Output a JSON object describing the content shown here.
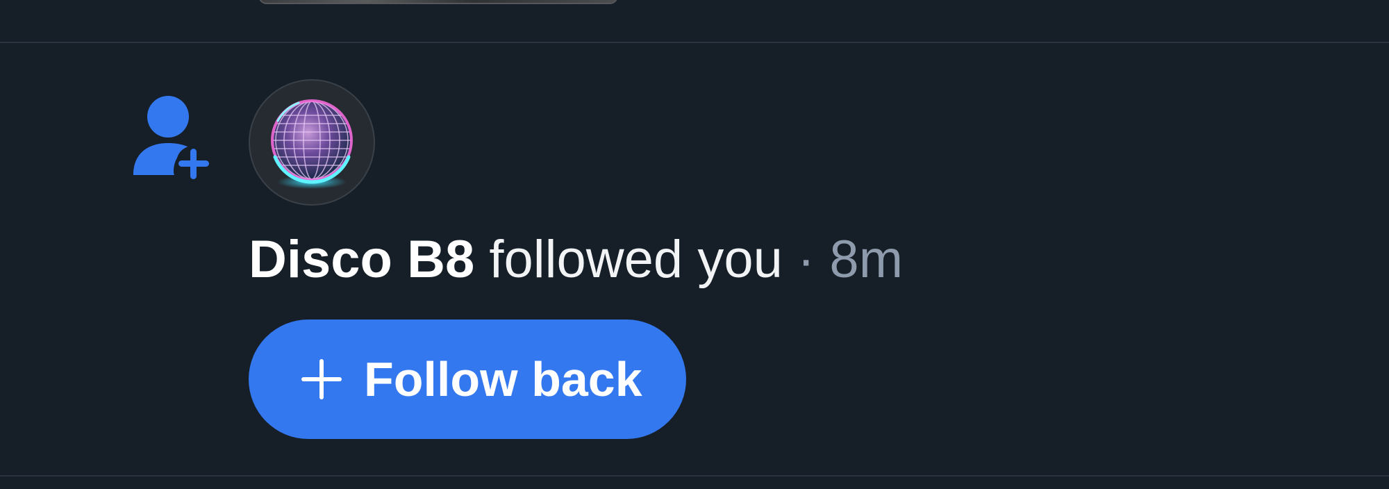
{
  "notification": {
    "type_icon": "person-plus-icon",
    "avatar_icon": "disco-ball-avatar",
    "actor_name": "Disco B8",
    "action_text": "followed you",
    "separator": "·",
    "time_ago": "8m"
  },
  "actions": {
    "follow_back_label": "Follow back",
    "follow_back_icon": "plus-icon"
  },
  "colors": {
    "background": "#161e27",
    "accent": "#3478f0",
    "divider": "#2a3441",
    "muted_text": "#8d9bac"
  }
}
